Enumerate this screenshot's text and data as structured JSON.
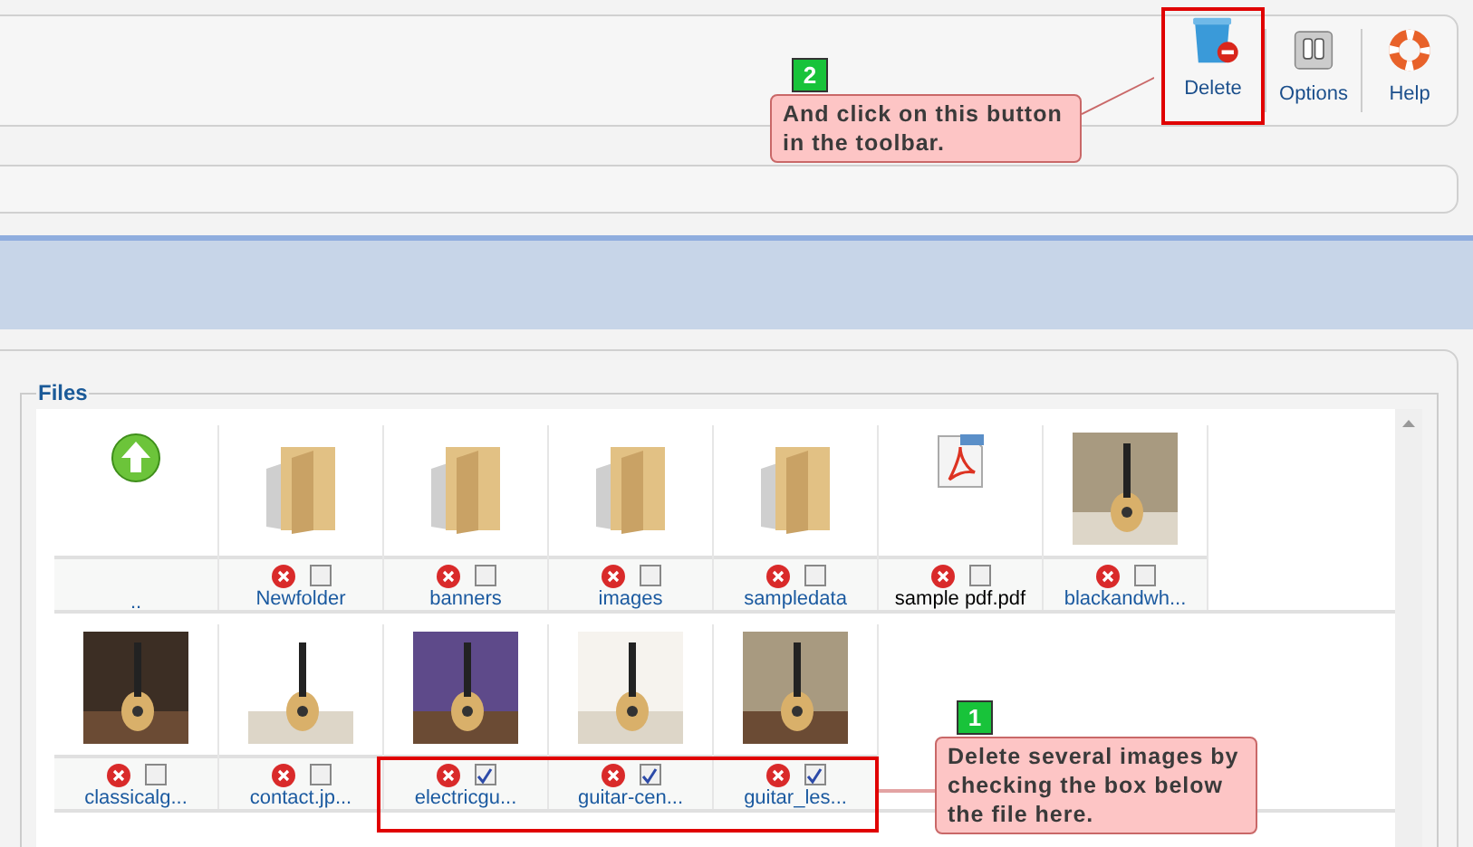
{
  "toolbar": {
    "buttons": [
      {
        "kind": "delete",
        "label": "Delete",
        "highlighted": true
      },
      {
        "kind": "options",
        "label": "Options",
        "highlighted": false
      },
      {
        "kind": "help",
        "label": "Help",
        "highlighted": false
      }
    ]
  },
  "files_panel": {
    "legend": "Files",
    "rows": [
      [
        {
          "kind": "up",
          "name": ".."
        },
        {
          "kind": "folder",
          "name": "Newfolder",
          "checked": false
        },
        {
          "kind": "folder",
          "name": "banners",
          "checked": false
        },
        {
          "kind": "folder",
          "name": "images",
          "checked": false
        },
        {
          "kind": "folder",
          "name": "sampledata",
          "checked": false
        },
        {
          "kind": "pdf",
          "name": "sample pdf.pdf",
          "checked": false
        },
        {
          "name": "blackandwh...",
          "checked": false
        }
      ],
      [
        {
          "name": "classicalg...",
          "checked": false
        },
        {
          "name": "contact.jp...",
          "checked": false
        },
        {
          "name": "electricgu...",
          "checked": true
        },
        {
          "name": "guitar-cen...",
          "checked": true
        },
        {
          "name": "guitar_les...",
          "checked": true
        }
      ]
    ]
  },
  "callouts": [
    {
      "number": "2",
      "text": "And click on this button in the toolbar."
    },
    {
      "number": "1",
      "text": "Delete several images by checking the box below the file here."
    }
  ]
}
